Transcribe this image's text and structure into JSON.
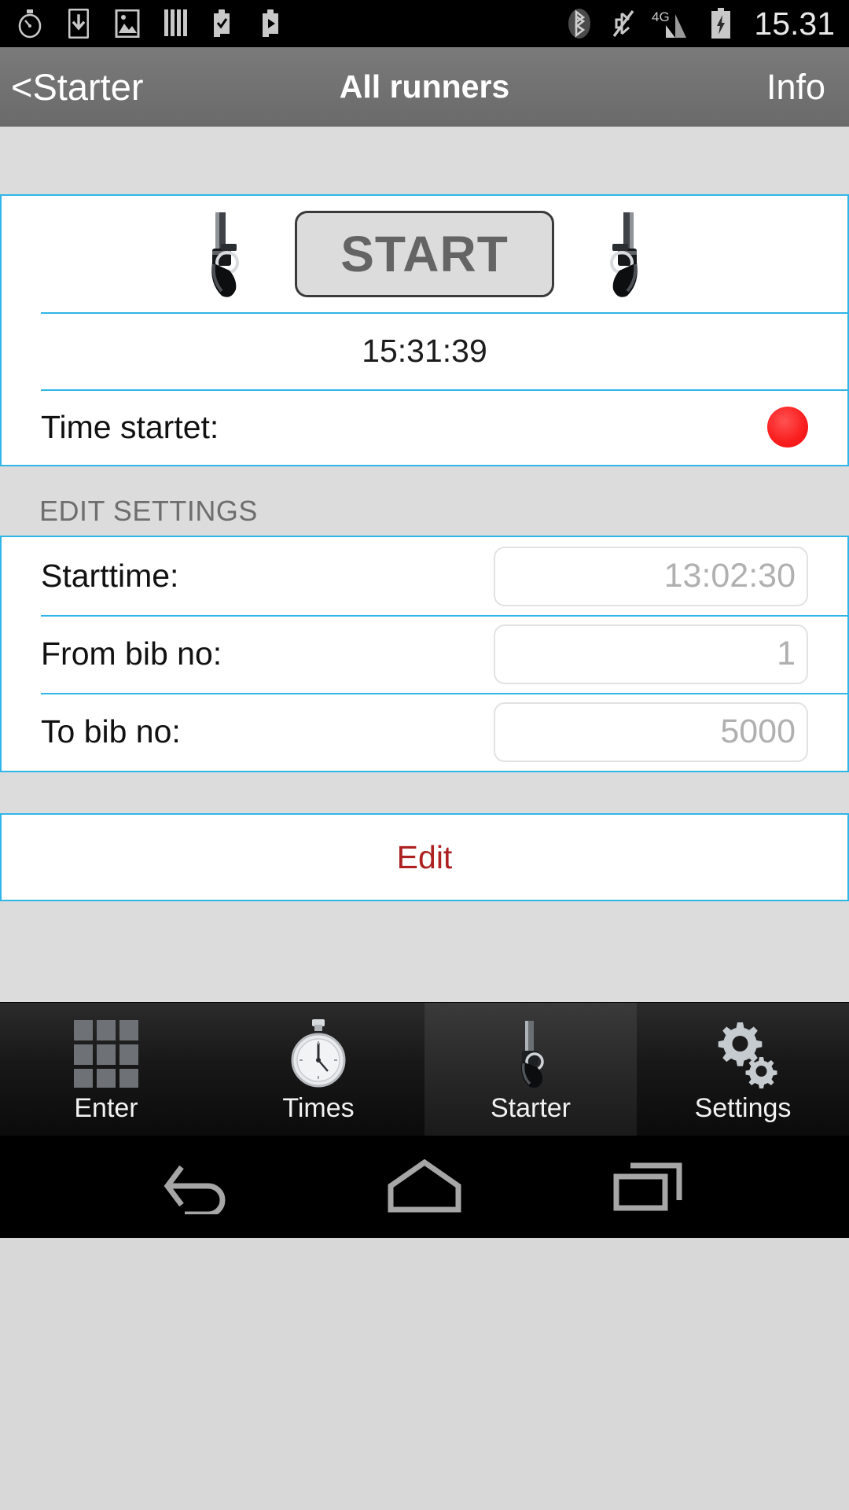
{
  "status_bar": {
    "icons_left": [
      "stopwatch-icon",
      "download-icon",
      "image-icon",
      "bookmarks-icon",
      "clipboard-check-icon",
      "clipboard-play-icon"
    ],
    "icons_right": [
      "bluetooth-icon",
      "mute-icon",
      "4g-signal-icon",
      "battery-charging-icon"
    ],
    "network_label": "4G",
    "clock": "15.31"
  },
  "nav_bar": {
    "back_label": "<Starter",
    "title": "All runners",
    "info_label": "Info"
  },
  "start_panel": {
    "start_button_label": "START",
    "left_icon": "revolver-icon",
    "right_icon": "revolver-icon",
    "current_time": "15:31:39",
    "time_started_label": "Time startet:",
    "status_indicator": "red-status-dot",
    "status_color": "#fa2121"
  },
  "edit_settings": {
    "header": "EDIT SETTINGS",
    "fields": [
      {
        "label": "Starttime:",
        "value": "13:02:30",
        "placeholder": "13:02:30"
      },
      {
        "label": "From bib no:",
        "value": "1",
        "placeholder": "1"
      },
      {
        "label": "To bib no:",
        "value": "5000",
        "placeholder": "5000"
      }
    ],
    "edit_button_label": "Edit",
    "edit_button_color": "#ad2121"
  },
  "tab_bar": {
    "tabs": [
      {
        "label": "Enter",
        "icon": "grid-icon",
        "active": false
      },
      {
        "label": "Times",
        "icon": "stopwatch-icon",
        "active": false
      },
      {
        "label": "Starter",
        "icon": "pistol-icon",
        "active": true
      },
      {
        "label": "Settings",
        "icon": "gears-icon",
        "active": false
      }
    ]
  },
  "android_nav": {
    "back": "back-icon",
    "home": "home-icon",
    "recents": "recents-icon"
  },
  "theme": {
    "accent": "#2fb6e8",
    "nav_bg": "#6f6f6f",
    "page_bg": "#dcdcdc"
  }
}
